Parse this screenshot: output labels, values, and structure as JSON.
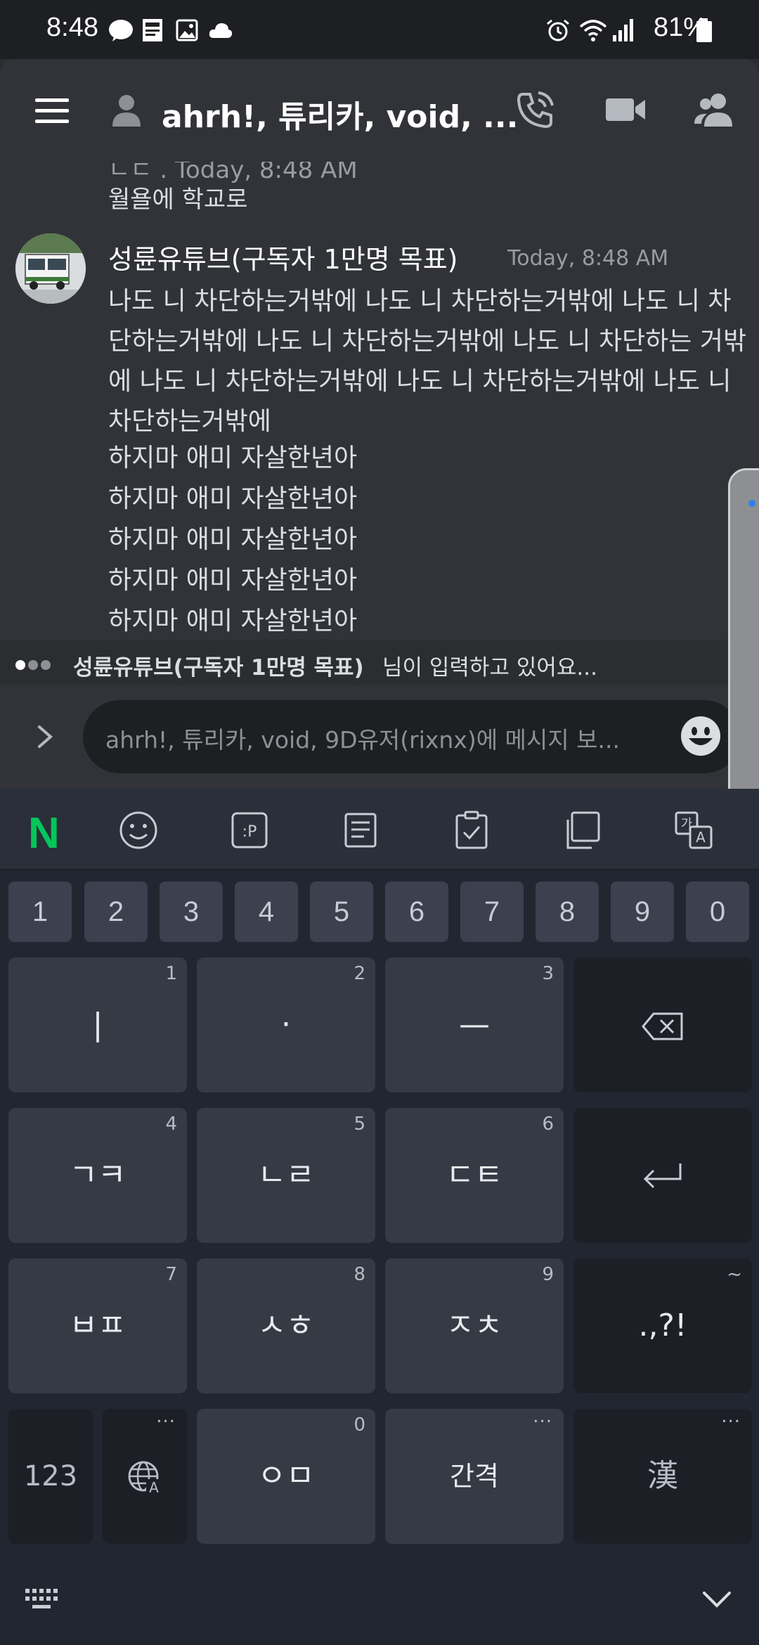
{
  "status_bar": {
    "time": "8:48",
    "battery": "81%",
    "notif_icons": [
      "talk-icon",
      "news-icon",
      "gallery-icon",
      "cloud-icon"
    ],
    "system_icons": [
      "alarm-icon",
      "wifi-icon",
      "signal-icon",
      "battery-icon"
    ]
  },
  "header": {
    "title": "ahrh!, 튜리카, void, ...",
    "buttons": [
      "call-icon",
      "video-icon",
      "members-icon"
    ]
  },
  "chat": {
    "prev_message_cut": "ㄴㄷ . Today, 8:48 AM",
    "prev_message_line": "월욜에 학교로",
    "message": {
      "author": "성륜유튜브(구독자 1만명 목표)",
      "timestamp": "Today, 8:48 AM",
      "body": "나도 니 차단하는거밖에 나도 니 차단하는거밖에 나도 니 차단하는거밖에 나도 니 차단하는거밖에 나도 니 차단하는 거밖에 나도 니 차단하는거밖에 나도 니 차단하는거밖에 나도 니 차단하는거밖에",
      "lines": [
        "하지마 애미 자살한년아",
        "하지마 애미 자살한년아",
        "하지마 애미 자살한년아",
        "하지마 애미 자살한년아",
        "하지마 애미 자살한년아"
      ]
    }
  },
  "typing": {
    "name": "성륜유튜브(구독자 1만명 목표)",
    "suffix": "님이 입력하고 있어요..."
  },
  "composer": {
    "placeholder": "ahrh!, 튜리카, void, 9D유저(rixnx)에 메시지 보..."
  },
  "keyboard": {
    "toolbar": [
      "naver-logo",
      "emoji-icon",
      "sticker-icon",
      "clipboard-text-icon",
      "checklist-icon",
      "copy-icon",
      "translate-icon"
    ],
    "naver_label": "N",
    "numbers": [
      "1",
      "2",
      "3",
      "4",
      "5",
      "6",
      "7",
      "8",
      "9",
      "0"
    ],
    "row1": [
      {
        "label": "|",
        "hint": "1"
      },
      {
        "label": "·",
        "hint": "2"
      },
      {
        "label": "—",
        "hint": "3"
      }
    ],
    "row2": [
      {
        "label": "ㄱㅋ",
        "hint": "4"
      },
      {
        "label": "ㄴㄹ",
        "hint": "5"
      },
      {
        "label": "ㄷㅌ",
        "hint": "6"
      }
    ],
    "row3": [
      {
        "label": "ㅂㅍ",
        "hint": "7"
      },
      {
        "label": "ㅅㅎ",
        "hint": "8"
      },
      {
        "label": "ㅈㅊ",
        "hint": "9"
      }
    ],
    "punct_label": ".,?!",
    "punct_hint": "~",
    "mode_label": "123",
    "zero_key_label": "ㅇㅁ",
    "zero_key_hint": "0",
    "space_label": "간격",
    "hanja_label": "漢",
    "more_hint": "..."
  },
  "colors": {
    "background": "#313338",
    "keyboard": "#222630",
    "naver_green": "#03c75a"
  }
}
